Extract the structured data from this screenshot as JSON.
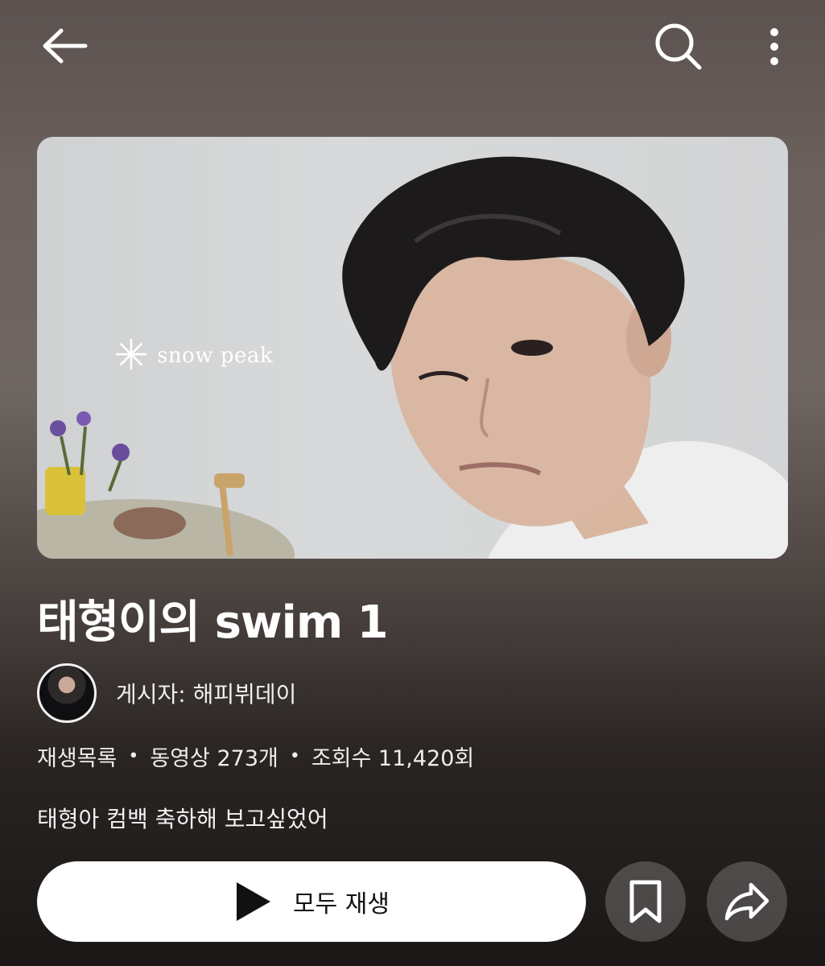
{
  "icons": {
    "back": "arrow-left-icon",
    "search": "search-icon",
    "more": "more-vertical-icon",
    "play": "play-icon",
    "save": "bookmark-icon",
    "share": "share-arrow-icon"
  },
  "thumbnail": {
    "brand_text": "snow peak"
  },
  "playlist": {
    "title": "태형이의 swim 1",
    "author": "게시자: 해피뷔데이",
    "type_label": "재생목록",
    "video_count": "동영상 273개",
    "view_count": "조회수 11,420회",
    "description": "태형아 컴백 축하해 보고싶었어"
  },
  "actions": {
    "play_all_label": "모두 재생"
  },
  "colors": {
    "background_top": "#5b5250",
    "background_bottom": "#1a1716",
    "play_button_bg": "#ffffff",
    "text": "#ffffff"
  }
}
